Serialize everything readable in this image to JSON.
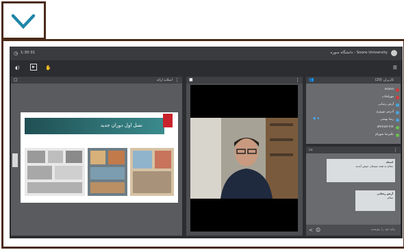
{
  "header": {
    "clock": "1:30:31",
    "title": "Soore University - دانشگاه سوره",
    "session_title": "کلاس ضبط شده"
  },
  "sidebar": {
    "section_title": "کاربران (20)",
    "users": [
      {
        "name": "asana",
        "color": "#d93a3a"
      },
      {
        "name": "مهرافتاب",
        "color": "#d93a3a"
      },
      {
        "name": "آرش رضایی",
        "color": "#4aa3df"
      },
      {
        "name": "آدرس نوروزی",
        "color": "#4aa3df"
      },
      {
        "name": "رضا بهمنی",
        "color": "#4aa3df"
      },
      {
        "name": "ahmad mir",
        "color": "#6ac24e"
      },
      {
        "name": "علیرضا شهرام",
        "color": "#6ac24e"
      }
    ]
  },
  "presentation": {
    "title": "اسلاید ارائه",
    "slide_heading": "نسل اول دوران جدید"
  },
  "chat": {
    "messages": [
      {
        "sender": "استاد",
        "text": "سلام به همه دوستان خوش آمدید"
      },
      {
        "sender": "آرش رضایی",
        "text": "سلام"
      }
    ],
    "input_placeholder": "پیام خود را بنویسید"
  },
  "colors": {
    "frame": "#4a2a18",
    "chevron": "#1f86a8",
    "app_bg": "#2c2d30"
  }
}
